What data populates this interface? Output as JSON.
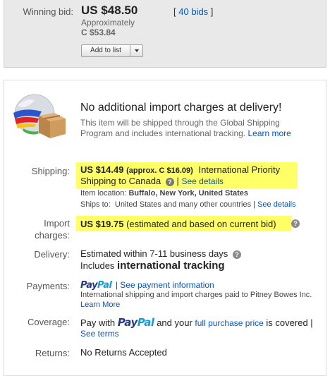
{
  "winning": {
    "label": "Winning bid:",
    "price": "US $48.50",
    "approx_label": "Approximately",
    "approx_value": "C $53.84",
    "bids_open": "[",
    "bids_link": "40 bids",
    "bids_close": "]",
    "add_to_list": "Add to list"
  },
  "notice": {
    "title": "No additional import charges at delivery!",
    "text": "This item will be shipped through the Global Shipping Program and includes international tracking.",
    "learn_more": "Learn more"
  },
  "shipping": {
    "label": "Shipping:",
    "price": "US $14.49",
    "approx": "(approx. C $16.09)",
    "service_a": "International Priority",
    "service_b": "Shipping to Canada",
    "sep": "|",
    "details_link": "See details",
    "item_location_label": "Item location:",
    "item_location": "Buffalo, New York, United States",
    "ships_to_label": "Ships to:",
    "ships_to": "United States and many other countries",
    "ships_to_link": "See details"
  },
  "import": {
    "label_a": "Import",
    "label_b": "charges:",
    "value": "US $19.75",
    "note": "(estimated and based on current bid)"
  },
  "delivery": {
    "label": "Delivery:",
    "estimate": "Estimated within 7-11 business days",
    "includes": "Includes",
    "tracking": "international tracking"
  },
  "payments": {
    "label": "Payments:",
    "paypal_a": "Pay",
    "paypal_b": "Pal",
    "sep": "|",
    "link": "See payment information",
    "note": "International shipping and import charges paid to Pitney Bowes Inc.",
    "learn_more": "Learn More"
  },
  "coverage": {
    "label": "Coverage:",
    "pay_with": "Pay with",
    "paypal_a": "Pay",
    "paypal_b": "Pal",
    "and_your": "and your",
    "link": "full purchase price",
    "covered": "is covered |",
    "terms": "See terms"
  },
  "returns": {
    "label": "Returns:",
    "value": "No Returns Accepted"
  },
  "colors": {
    "highlight": "#ffff66",
    "link": "#0654ba",
    "paypal_dark": "#253b80",
    "paypal_light": "#179bd7"
  },
  "icons": [
    "globe-box-icon",
    "help-icon",
    "chevron-down-icon"
  ]
}
